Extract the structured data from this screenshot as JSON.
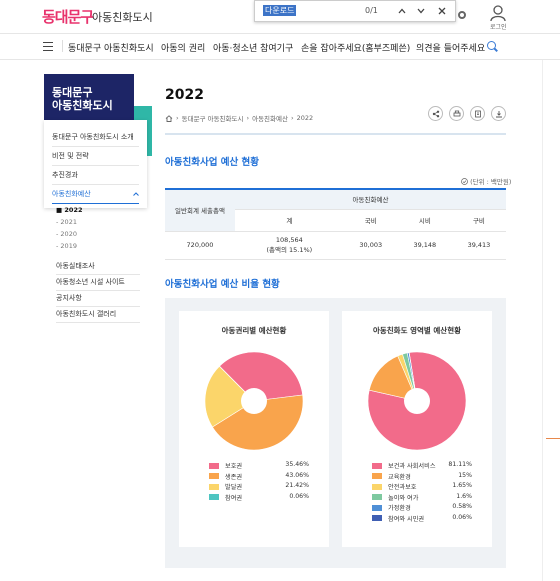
{
  "header": {
    "logo_text": "동대문구",
    "site_name": "아동친화도시",
    "find_bar": {
      "query": "다운로드",
      "count": "0/1"
    },
    "login_label": "로그인"
  },
  "nav": {
    "items": [
      "동대문구 아동친화도시",
      "아동의 권리",
      "아동·청소년 참여기구",
      "손을 잡아주세요(홈부즈페쓴)",
      "의견을 들어주세요"
    ]
  },
  "sidebar": {
    "title_line1": "동대문구",
    "title_line2": "아동친화도시",
    "items": [
      "동대문구 아동친화도시 소개",
      "비전 및 전략",
      "추진경과",
      "아동친화예산"
    ],
    "active_item": "아동친화예산",
    "sub_items": [
      "2022",
      "2021",
      "2020",
      "2019"
    ],
    "links": [
      "아동실태조사",
      "아동청소년 시설 사이트",
      "공지사항",
      "아동친화도시 갤러리"
    ]
  },
  "main": {
    "page_title": "2022",
    "breadcrumb": [
      "동대문구 아동친화도시",
      "아동친화예산",
      "2022"
    ],
    "section1_title": "아동친화사업 예산 현황",
    "unit_label": "(단위 : 백만원)",
    "table": {
      "col_general": "일반회계 세출총액",
      "col_group": "아동친화예산",
      "sub_cols": [
        "계",
        "국비",
        "시비",
        "구비"
      ],
      "row": {
        "general": "720,000",
        "total_line1": "108,564",
        "total_line2": "(총액의 15.1%)",
        "national": "30,003",
        "city": "39,148",
        "district": "39,413"
      }
    },
    "section2_title": "아동친화사업 예산 비율 현황"
  },
  "chart_data": [
    {
      "type": "pie",
      "title": "아동권리별 예산현황",
      "labels": [
        "보호권",
        "생존권",
        "발달권",
        "참여권"
      ],
      "values": [
        35.46,
        43.06,
        21.42,
        0.06
      ],
      "value_labels": [
        "35.46%",
        "43.06%",
        "21.42%",
        "0.06%"
      ],
      "colors": [
        "#f26b8a",
        "#f9a44c",
        "#fbd56a",
        "#4ec5c1"
      ]
    },
    {
      "type": "pie",
      "title": "아동친화도 영역별 예산현황",
      "labels": [
        "보건과 사회서비스",
        "교육환경",
        "안전과보호",
        "놀이와 여가",
        "가정환경",
        "참여와 시민권"
      ],
      "values": [
        81.11,
        15,
        1.65,
        1.6,
        0.58,
        0.06
      ],
      "value_labels": [
        "81.11%",
        "15%",
        "1.65%",
        "1.6%",
        "0.58%",
        "0.06%"
      ],
      "colors": [
        "#f26b8a",
        "#f9a44c",
        "#fbd56a",
        "#7ec9a0",
        "#4f8fd6",
        "#3f5fb3"
      ]
    }
  ]
}
